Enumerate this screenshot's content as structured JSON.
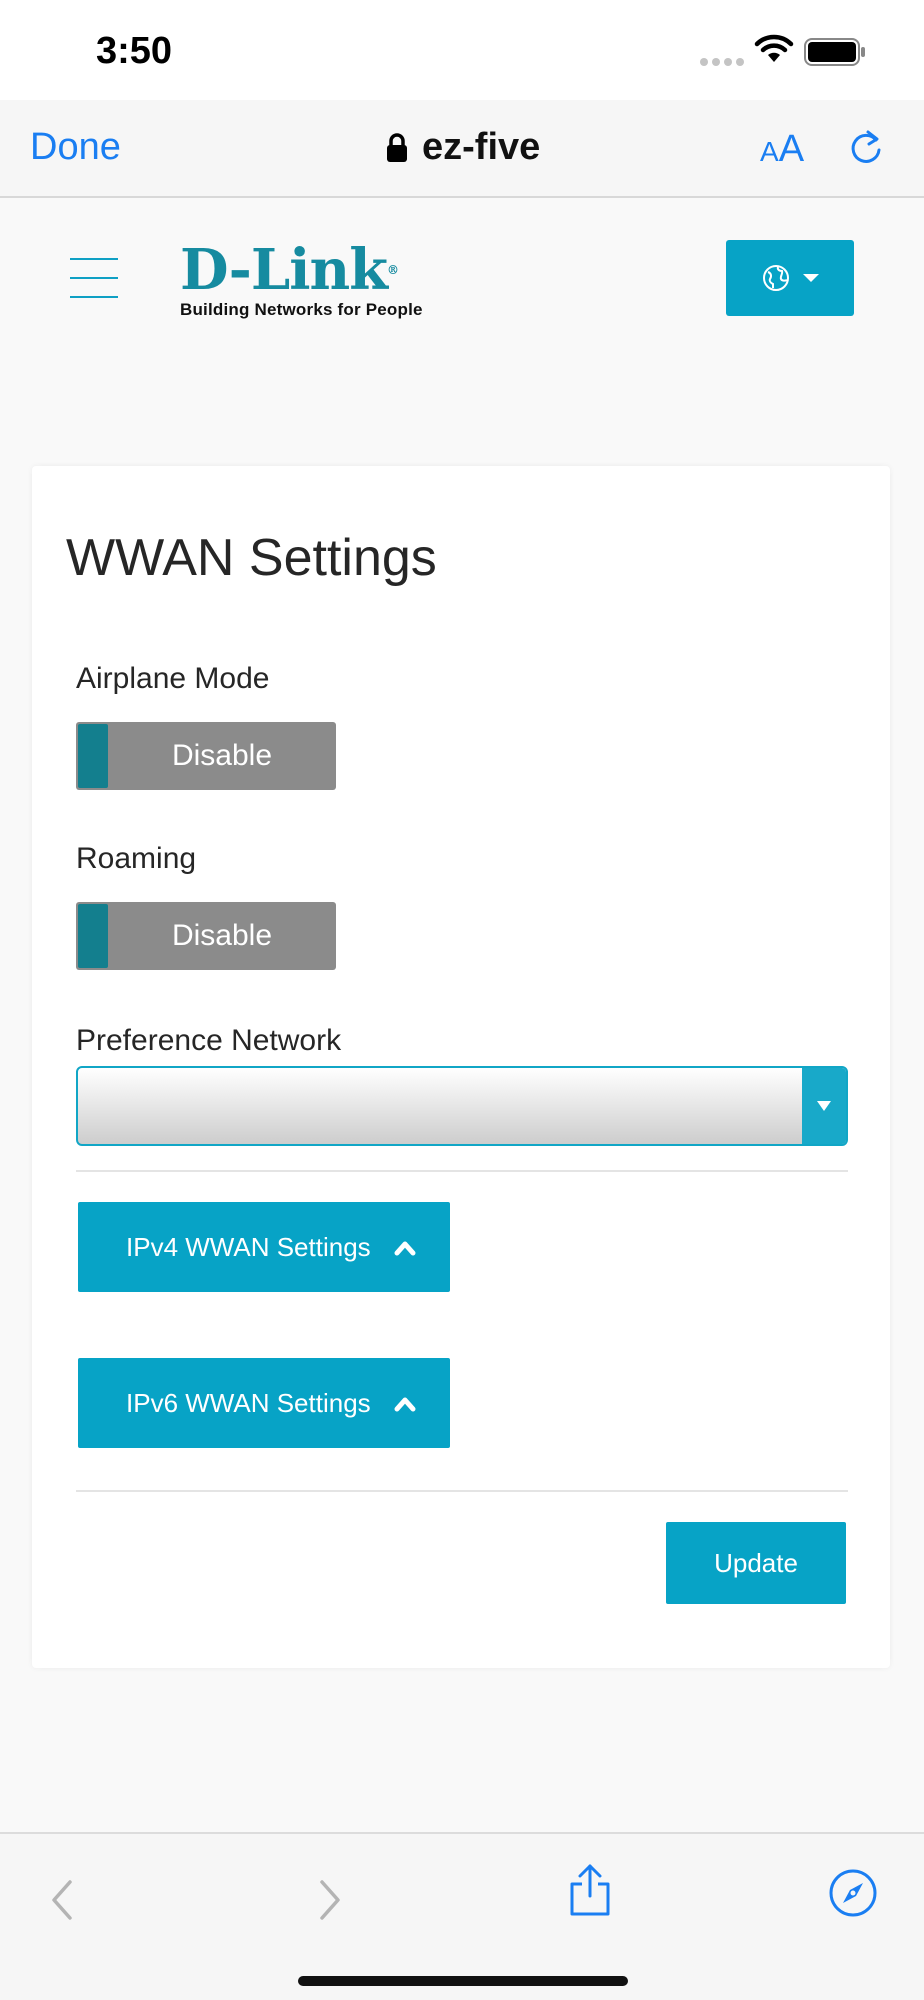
{
  "status_bar": {
    "time": "3:50"
  },
  "browser": {
    "done_label": "Done",
    "url": "ez-five",
    "text_size_small": "A",
    "text_size_big": "A"
  },
  "header": {
    "logo_text": "D-Link",
    "logo_registered": "®",
    "logo_tagline": "Building Networks for People"
  },
  "page": {
    "title": "WWAN Settings",
    "airplane_mode": {
      "label": "Airplane Mode",
      "state": "Disable"
    },
    "roaming": {
      "label": "Roaming",
      "state": "Disable"
    },
    "preference_network": {
      "label": "Preference Network",
      "value": ""
    },
    "ipv4_section_label": "IPv4 WWAN Settings",
    "ipv6_section_label": "IPv6 WWAN Settings",
    "update_label": "Update"
  },
  "colors": {
    "accent": "#07a3c6",
    "toggle_knob": "#137f8e",
    "toggle_off": "#8b8b8b",
    "ios_blue": "#1a7ef2"
  }
}
